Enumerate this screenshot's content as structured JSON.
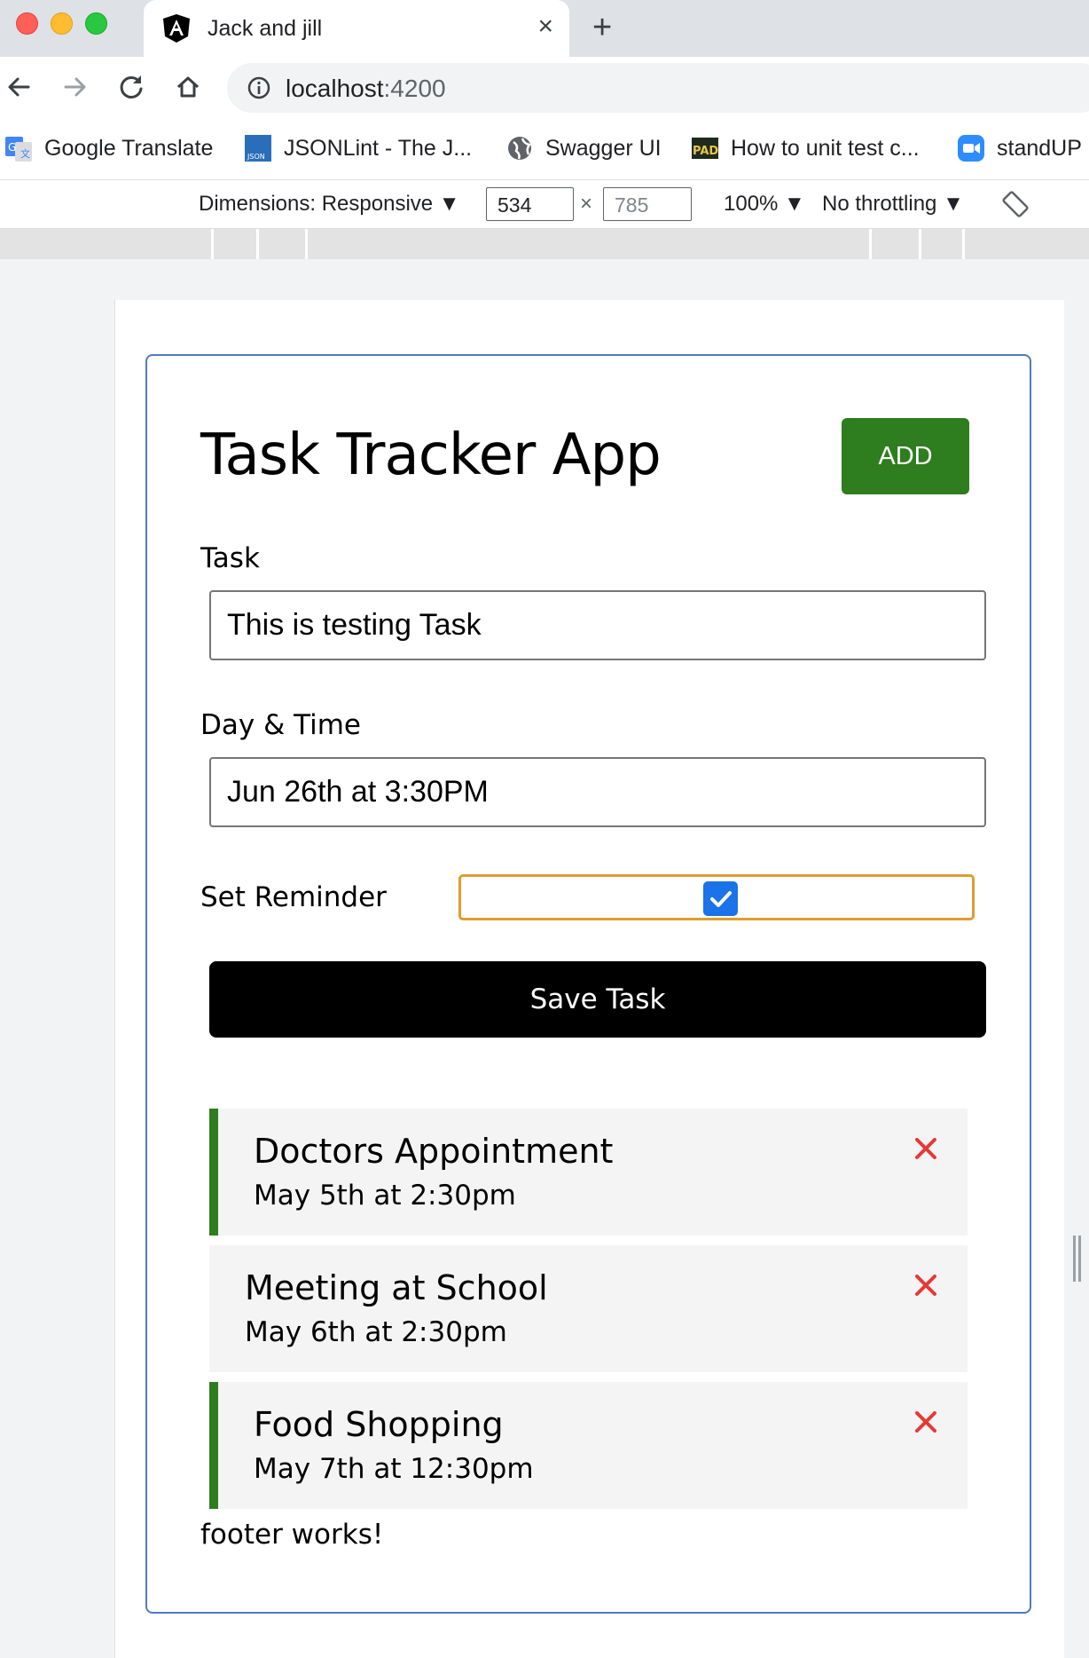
{
  "browser": {
    "tab_title": "Jack and jill",
    "new_tab_symbol": "+",
    "close_symbol": "×",
    "url_host": "localhost",
    "url_port": ":4200"
  },
  "bookmarks": [
    {
      "label": "Google Translate",
      "icon": "google-translate-icon"
    },
    {
      "label": "JSONLint - The J...",
      "icon": "jsonlint-icon"
    },
    {
      "label": "Swagger UI",
      "icon": "globe-icon"
    },
    {
      "label": "How to unit test c...",
      "icon": "pad-icon"
    },
    {
      "label": "standUP",
      "icon": "zoom-icon"
    }
  ],
  "devtools": {
    "dimensions_label": "Dimensions: Responsive ▼",
    "width_value": "534",
    "times_symbol": "×",
    "height_value": "785",
    "zoom_label": "100% ▼",
    "throttle_label": "No throttling ▼"
  },
  "app": {
    "title": "Task Tracker App",
    "add_button_label": "ADD",
    "task_label": "Task",
    "task_value": "This is testing Task",
    "day_label": "Day & Time",
    "day_value": "Jun 26th at 3:30PM",
    "reminder_label": "Set Reminder",
    "reminder_checked": true,
    "save_button_label": "Save Task",
    "footer_text": "footer works!",
    "colors": {
      "add_button": "#2e7d1f",
      "reminder_border": "#2e7d1f",
      "delete_x": "#e53935",
      "container_border": "#4f7bbf"
    }
  },
  "tasks": [
    {
      "text": "Doctors Appointment",
      "day": "May 5th at 2:30pm",
      "reminder": true
    },
    {
      "text": "Meeting at School",
      "day": "May 6th at 2:30pm",
      "reminder": false
    },
    {
      "text": "Food Shopping",
      "day": "May 7th at 12:30pm",
      "reminder": true
    }
  ]
}
